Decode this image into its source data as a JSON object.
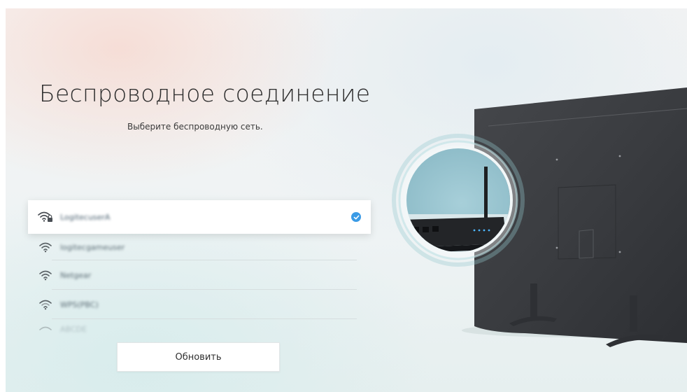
{
  "page": {
    "title": "Беспроводное соединение",
    "subtitle": "Выберите беспроводную сеть."
  },
  "networks": [
    {
      "name": "LogitecuserA",
      "secured": true,
      "selected": true
    },
    {
      "name": "logitecgameuser",
      "secured": false,
      "selected": false
    },
    {
      "name": "Netgear",
      "secured": false,
      "selected": false
    },
    {
      "name": "WPS(PBC)",
      "secured": false,
      "selected": false
    },
    {
      "name": "ABCDE",
      "secured": false,
      "selected": false
    }
  ],
  "actions": {
    "refresh_label": "Обновить"
  },
  "icons": {
    "wifi": "wifi-icon",
    "wifi_secured": "wifi-lock-icon",
    "selected": "check-circle-icon"
  },
  "colors": {
    "accent": "#3b9be6",
    "text": "#2c2c2c",
    "tv_panel": "#3b3d40"
  }
}
